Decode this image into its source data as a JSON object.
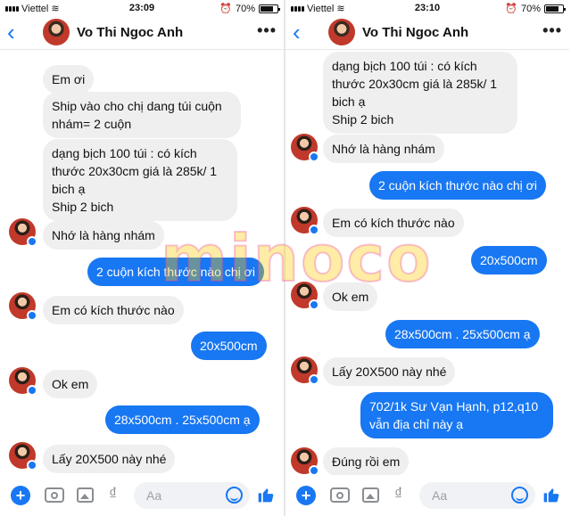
{
  "status_left": {
    "carrier": "Viettel",
    "time": "23:09",
    "battery": "70%"
  },
  "status_right": {
    "carrier": "Viettel",
    "time": "23:10",
    "battery": "70%"
  },
  "contact": {
    "name": "Vo Thi Ngoc Anh"
  },
  "icons": {
    "back": "chevron-left-icon",
    "more": "more-dots-icon",
    "plus": "plus-circle-icon",
    "camera": "camera-icon",
    "gallery": "image-icon",
    "currency": "dong-icon",
    "emoji": "emoji-icon",
    "like": "thumbs-up-icon"
  },
  "composer": {
    "placeholder": "Aa"
  },
  "colors": {
    "accent": "#1877f2",
    "incoming_bubble": "#efefef"
  },
  "left_messages": [
    {
      "dir": "in",
      "text": "Em ơi"
    },
    {
      "dir": "in",
      "text": "Ship vào cho chị dang túi cuộn\nnhám= 2 cuộn"
    },
    {
      "dir": "in",
      "text": "dạng bịch 100 túi : có kích\nthước 20x30cm giá là 285k/ 1\nbich ạ\nShip 2 bich"
    },
    {
      "dir": "in",
      "text": "Nhớ là hàng nhám"
    },
    {
      "dir": "out",
      "text": "2 cuộn kích thước nào chị ơi"
    },
    {
      "dir": "in",
      "text": "Em có kích thước nào"
    },
    {
      "dir": "out",
      "text": "20x500cm"
    },
    {
      "dir": "in",
      "text": "Ok em"
    },
    {
      "dir": "out",
      "text": "28x500cm . 25x500cm ạ"
    },
    {
      "dir": "in",
      "text": "Lấy 20X500 này nhé"
    }
  ],
  "right_messages": [
    {
      "dir": "in",
      "text": "dạng bịch 100 túi : có kích\nthước 20x30cm giá là 285k/ 1\nbich ạ\nShip 2 bich"
    },
    {
      "dir": "in",
      "text": "Nhớ là hàng nhám"
    },
    {
      "dir": "out",
      "text": "2 cuộn kích thước nào chị ơi"
    },
    {
      "dir": "in",
      "text": "Em có kích thước nào"
    },
    {
      "dir": "out",
      "text": "20x500cm"
    },
    {
      "dir": "in",
      "text": "Ok em"
    },
    {
      "dir": "out",
      "text": "28x500cm . 25x500cm ạ"
    },
    {
      "dir": "in",
      "text": "Lấy 20X500 này nhé"
    },
    {
      "dir": "out",
      "text": "702/1k Sư Vạn Hạnh, p12,q10\nvẫn địa chỉ này ạ"
    },
    {
      "dir": "in",
      "text": "Đúng rồi em"
    }
  ],
  "watermark": "minoco"
}
